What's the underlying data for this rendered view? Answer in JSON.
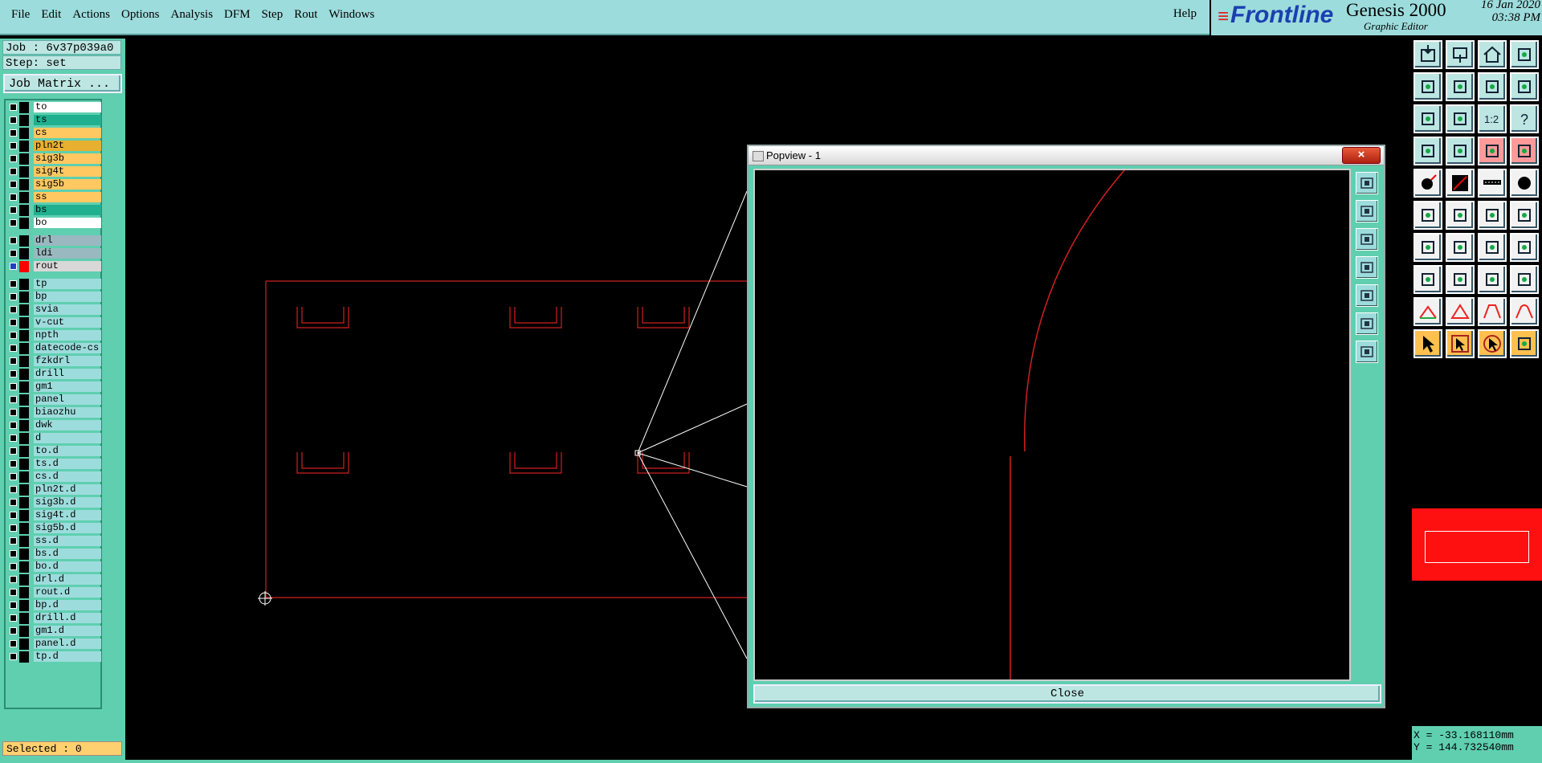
{
  "menu": {
    "items": [
      "File",
      "Edit",
      "Actions",
      "Options",
      "Analysis",
      "DFM",
      "Step",
      "Rout",
      "Windows"
    ],
    "help": "Help"
  },
  "brand": {
    "logo": "Frontline",
    "product": "Genesis 2000",
    "subtitle": "Graphic Editor",
    "date": "16 Jan 2020",
    "time": "03:38 PM"
  },
  "job": {
    "job_label": "Job : 6v37p039a0",
    "step_label": "Step: set",
    "matrix_button": "Job Matrix ..."
  },
  "layers": [
    {
      "name": "to",
      "color": "#ffffff"
    },
    {
      "name": "ts",
      "color": "#20b090"
    },
    {
      "name": "cs",
      "color": "#ffc860"
    },
    {
      "name": "pln2t",
      "color": "#e8b030"
    },
    {
      "name": "sig3b",
      "color": "#ffc860"
    },
    {
      "name": "sig4t",
      "color": "#ffc860"
    },
    {
      "name": "sig5b",
      "color": "#ffc860"
    },
    {
      "name": "ss",
      "color": "#ffc860"
    },
    {
      "name": "bs",
      "color": "#20b090"
    },
    {
      "name": "bo",
      "color": "#ffffff"
    },
    {
      "name": "drl",
      "color": "#9ab8c0"
    },
    {
      "name": "ldi",
      "color": "#9ab8c0"
    },
    {
      "name": "rout",
      "color": "#d8d8d8",
      "active": true
    },
    {
      "name": "tp",
      "color": "#9ddcdc"
    },
    {
      "name": "bp",
      "color": "#9ddcdc"
    },
    {
      "name": "svia",
      "color": "#9ddcdc"
    },
    {
      "name": "v-cut",
      "color": "#9ddcdc"
    },
    {
      "name": "npth",
      "color": "#9ddcdc"
    },
    {
      "name": "datecode-cs",
      "color": "#9ddcdc"
    },
    {
      "name": "fzkdrl",
      "color": "#9ddcdc"
    },
    {
      "name": "drill",
      "color": "#9ddcdc"
    },
    {
      "name": "gm1",
      "color": "#9ddcdc"
    },
    {
      "name": "panel",
      "color": "#9ddcdc"
    },
    {
      "name": "biaozhu",
      "color": "#9ddcdc"
    },
    {
      "name": "dwk",
      "color": "#9ddcdc"
    },
    {
      "name": "d",
      "color": "#9ddcdc"
    },
    {
      "name": "to.d",
      "color": "#9ddcdc"
    },
    {
      "name": "ts.d",
      "color": "#9ddcdc"
    },
    {
      "name": "cs.d",
      "color": "#9ddcdc"
    },
    {
      "name": "pln2t.d",
      "color": "#9ddcdc"
    },
    {
      "name": "sig3b.d",
      "color": "#9ddcdc"
    },
    {
      "name": "sig4t.d",
      "color": "#9ddcdc"
    },
    {
      "name": "sig5b.d",
      "color": "#9ddcdc"
    },
    {
      "name": "ss.d",
      "color": "#9ddcdc"
    },
    {
      "name": "bs.d",
      "color": "#9ddcdc"
    },
    {
      "name": "bo.d",
      "color": "#9ddcdc"
    },
    {
      "name": "drl.d",
      "color": "#9ddcdc"
    },
    {
      "name": "rout.d",
      "color": "#9ddcdc"
    },
    {
      "name": "bp.d",
      "color": "#9ddcdc"
    },
    {
      "name": "drill.d",
      "color": "#9ddcdc"
    },
    {
      "name": "gm1.d",
      "color": "#9ddcdc"
    },
    {
      "name": "panel.d",
      "color": "#9ddcdc"
    },
    {
      "name": "tp.d",
      "color": "#9ddcdc"
    }
  ],
  "status": {
    "selected": "Selected : 0",
    "x": "X = -33.168110mm",
    "y": "Y = 144.732540mm"
  },
  "popview": {
    "title": "Popview - 1",
    "close_x": "×",
    "close_button": "Close"
  },
  "popview_tools": [
    "zoom-window-icon",
    "zoom-in-icon",
    "zoom-out-icon",
    "pan-left-icon",
    "pan-right-icon",
    "fit-screen-icon",
    "zoom-home-icon"
  ],
  "toolbar": [
    {
      "icon": "import-icon",
      "style": ""
    },
    {
      "icon": "export-icon",
      "style": ""
    },
    {
      "icon": "home-icon",
      "style": ""
    },
    {
      "icon": "split-view-icon",
      "style": ""
    },
    {
      "icon": "move-left-icon",
      "style": ""
    },
    {
      "icon": "move-right-icon",
      "style": ""
    },
    {
      "icon": "rotate-icon",
      "style": ""
    },
    {
      "icon": "mirror-icon",
      "style": ""
    },
    {
      "icon": "zoom-fit-icon",
      "style": ""
    },
    {
      "icon": "zoom-center-icon",
      "style": ""
    },
    {
      "icon": "scale-icon",
      "style": ""
    },
    {
      "icon": "help-icon",
      "style": ""
    },
    {
      "icon": "measure-icon",
      "style": ""
    },
    {
      "icon": "probe-icon",
      "style": ""
    },
    {
      "icon": "net-icon",
      "style": "pink"
    },
    {
      "icon": "net-alt-icon",
      "style": "pink"
    },
    {
      "icon": "add-pad-icon",
      "style": "white"
    },
    {
      "icon": "add-line-icon",
      "style": "white"
    },
    {
      "icon": "add-dash-icon",
      "style": "white"
    },
    {
      "icon": "add-circle-icon",
      "style": "white"
    },
    {
      "icon": "connect-icon",
      "style": "white"
    },
    {
      "icon": "intersect-icon",
      "style": "white"
    },
    {
      "icon": "move-point-icon",
      "style": "white"
    },
    {
      "icon": "extend-icon",
      "style": "white"
    },
    {
      "icon": "draw-line-icon",
      "style": "white"
    },
    {
      "icon": "draw-diag-icon",
      "style": "white"
    },
    {
      "icon": "arc-icon",
      "style": "white"
    },
    {
      "icon": "text-icon",
      "style": "white"
    },
    {
      "icon": "edit-pad-icon",
      "style": "white"
    },
    {
      "icon": "trim-icon",
      "style": "white"
    },
    {
      "icon": "snap-icon",
      "style": "white"
    },
    {
      "icon": "group-icon",
      "style": "white"
    },
    {
      "icon": "polygon-icon",
      "style": "white"
    },
    {
      "icon": "triangle-icon",
      "style": "white"
    },
    {
      "icon": "trapezoid-icon",
      "style": "white"
    },
    {
      "icon": "arch-icon",
      "style": "white"
    },
    {
      "icon": "select-icon",
      "style": "orange"
    },
    {
      "icon": "select-box-icon",
      "style": "orange"
    },
    {
      "icon": "select-circle-icon",
      "style": "orange"
    },
    {
      "icon": "select-net-icon",
      "style": "orange"
    }
  ]
}
